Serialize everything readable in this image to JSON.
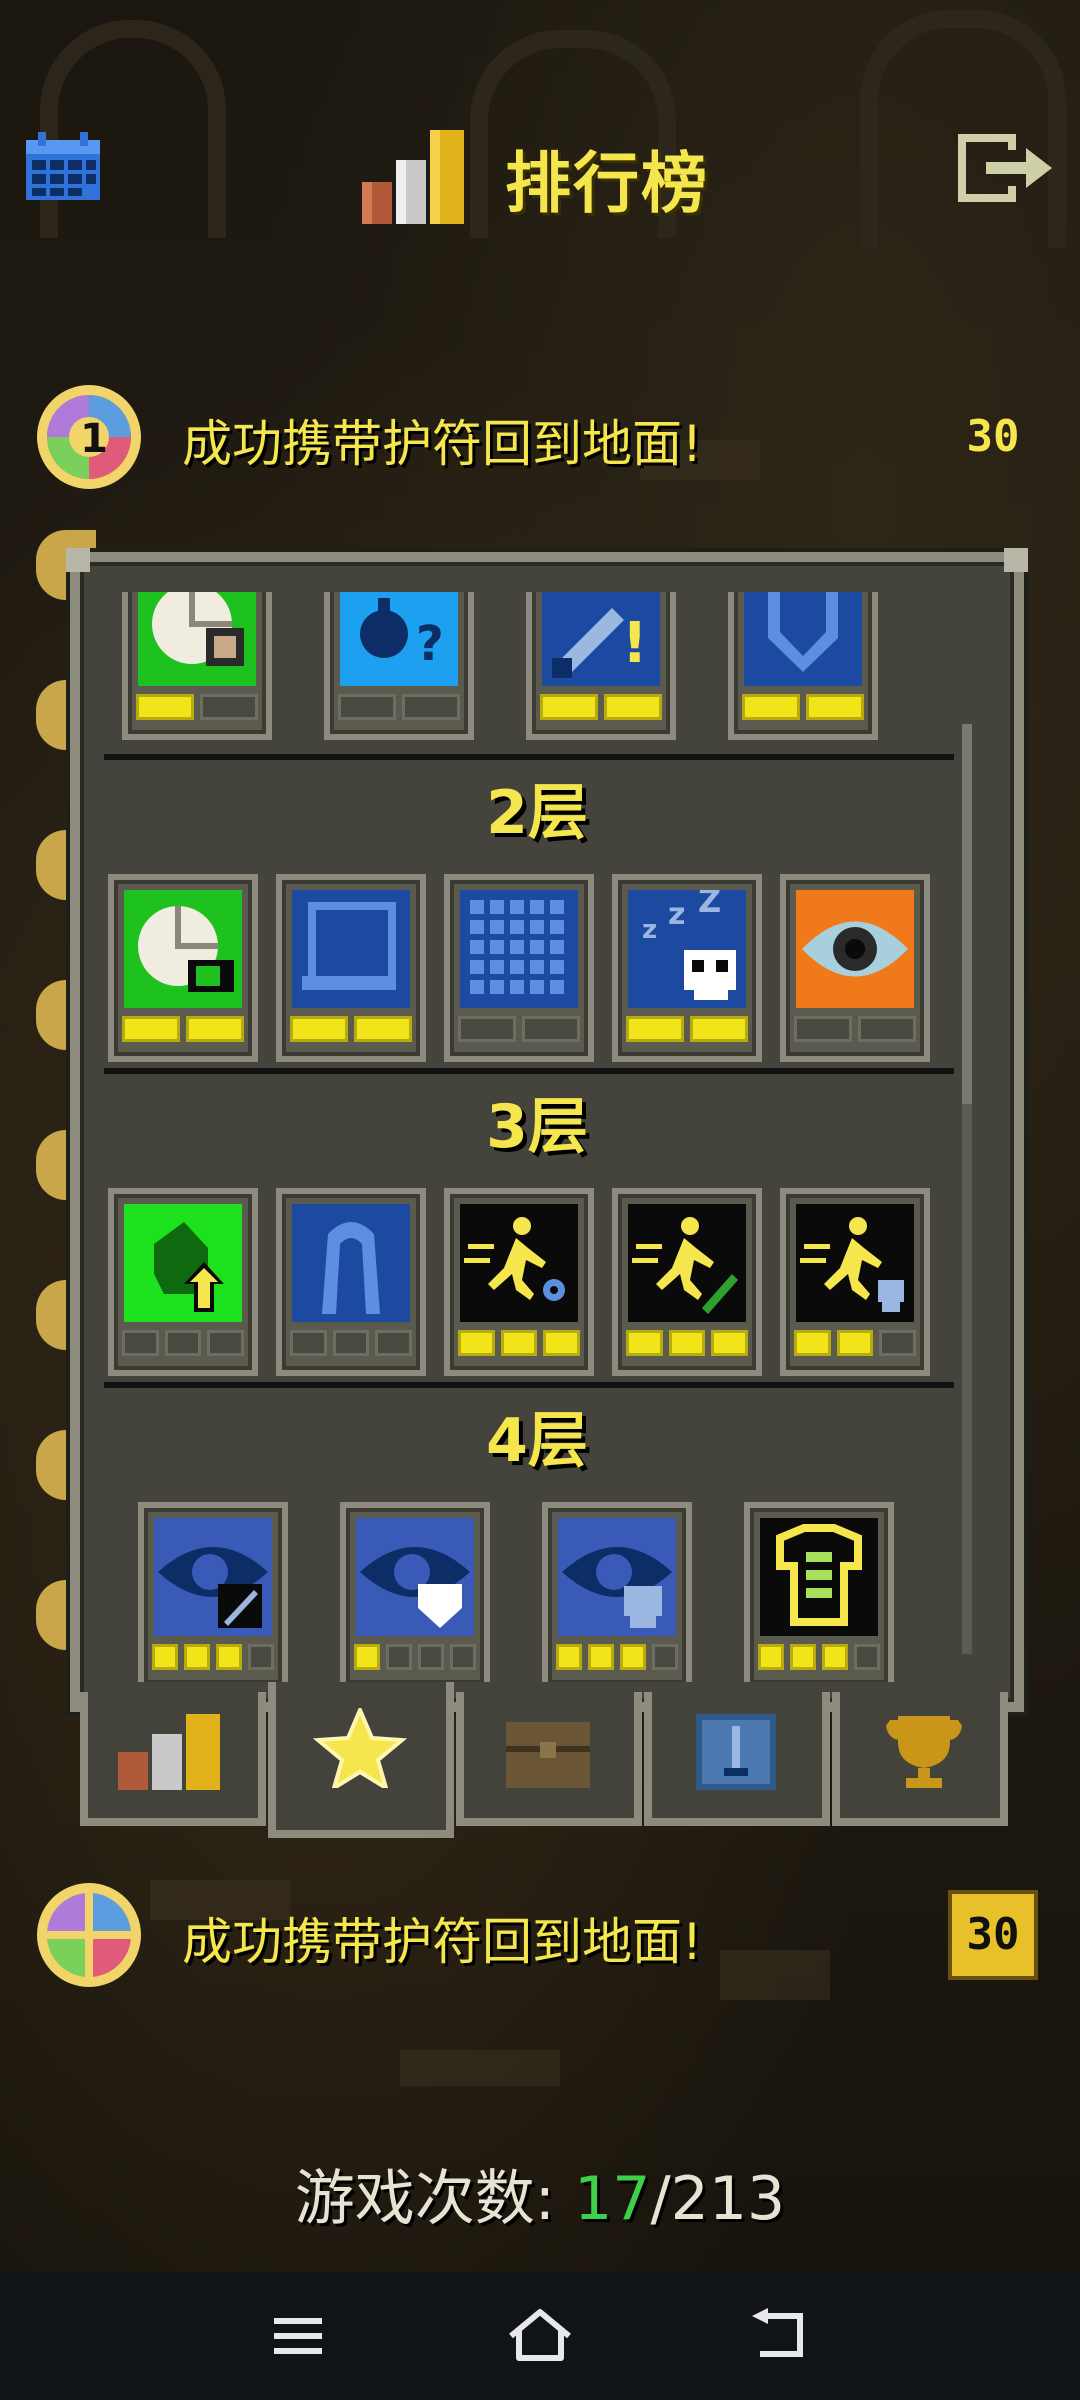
{
  "header": {
    "title": "排行榜",
    "icons": {
      "calendar": "calendar-icon",
      "chart": "bar-chart-icon",
      "exit": "exit-icon"
    }
  },
  "rankings": {
    "top_row": {
      "rank": "1",
      "text": "成功携带护符回到地面!",
      "score": "30"
    },
    "bottom_row": {
      "text": "成功携带护符回到地面!",
      "score": "30"
    }
  },
  "badges_window": {
    "partial_row": [
      {
        "icon": "map-chest-icon",
        "bg": "#1ec21e",
        "filled": 2,
        "total": 2
      },
      {
        "icon": "potion-question-icon",
        "bg": "#1ea0f0",
        "filled": 0,
        "total": 2
      },
      {
        "icon": "sword-exclaim-icon",
        "bg": "#1c4aa0",
        "filled": 2,
        "total": 2
      },
      {
        "icon": "shield-icon",
        "bg": "#1c4aa0",
        "filled": 2,
        "total": 2
      }
    ],
    "floors": [
      {
        "title": "2层",
        "badges": [
          {
            "icon": "map-key-icon",
            "bg": "#1ec21e",
            "filled": 2,
            "total": 2
          },
          {
            "icon": "scroll-icon",
            "bg": "#1c4aa0",
            "filled": 2,
            "total": 2
          },
          {
            "icon": "grid-icon",
            "bg": "#1c4aa0",
            "filled": 0,
            "total": 2
          },
          {
            "icon": "sleeping-skull-icon",
            "bg": "#1c4aa0",
            "filled": 2,
            "total": 2
          },
          {
            "icon": "eye-icon",
            "bg": "#f07a1a",
            "filled": 0,
            "total": 2
          }
        ]
      },
      {
        "title": "3层",
        "badges": [
          {
            "icon": "seed-arrow-icon",
            "bg": "#1ee11e",
            "filled": 0,
            "total": 3
          },
          {
            "icon": "robe-icon",
            "bg": "#1c4aa0",
            "filled": 0,
            "total": 3
          },
          {
            "icon": "running-hero-gear-icon",
            "bg": "#0a0a0a",
            "filled": 3,
            "total": 3
          },
          {
            "icon": "running-hero-dart-icon",
            "bg": "#0a0a0a",
            "filled": 3,
            "total": 3
          },
          {
            "icon": "running-hero-skull-icon",
            "bg": "#0a0a0a",
            "filled": 2,
            "total": 3
          }
        ]
      },
      {
        "title": "4层",
        "badges": [
          {
            "icon": "eye-sword-icon",
            "bg": "#3a5ab8",
            "filled": 3,
            "total": 4
          },
          {
            "icon": "eye-shield-icon",
            "bg": "#3a5ab8",
            "filled": 1,
            "total": 4
          },
          {
            "icon": "eye-skull-icon",
            "bg": "#3a5ab8",
            "filled": 3,
            "total": 4
          },
          {
            "icon": "armor-icon",
            "bg": "#0a0a0a",
            "filled": 3,
            "total": 4
          }
        ]
      }
    ]
  },
  "tabs": [
    {
      "icon": "rankings-tab-icon",
      "active": false
    },
    {
      "icon": "star-tab-icon",
      "active": true
    },
    {
      "icon": "chest-tab-icon",
      "active": false
    },
    {
      "icon": "sword-tab-icon",
      "active": false
    },
    {
      "icon": "trophy-tab-icon",
      "active": false
    }
  ],
  "footer": {
    "label": "游戏次数: ",
    "current": "17",
    "separator": "/",
    "total": "213"
  },
  "navbar": {
    "icons": [
      "menu-icon",
      "home-icon",
      "back-icon"
    ]
  }
}
